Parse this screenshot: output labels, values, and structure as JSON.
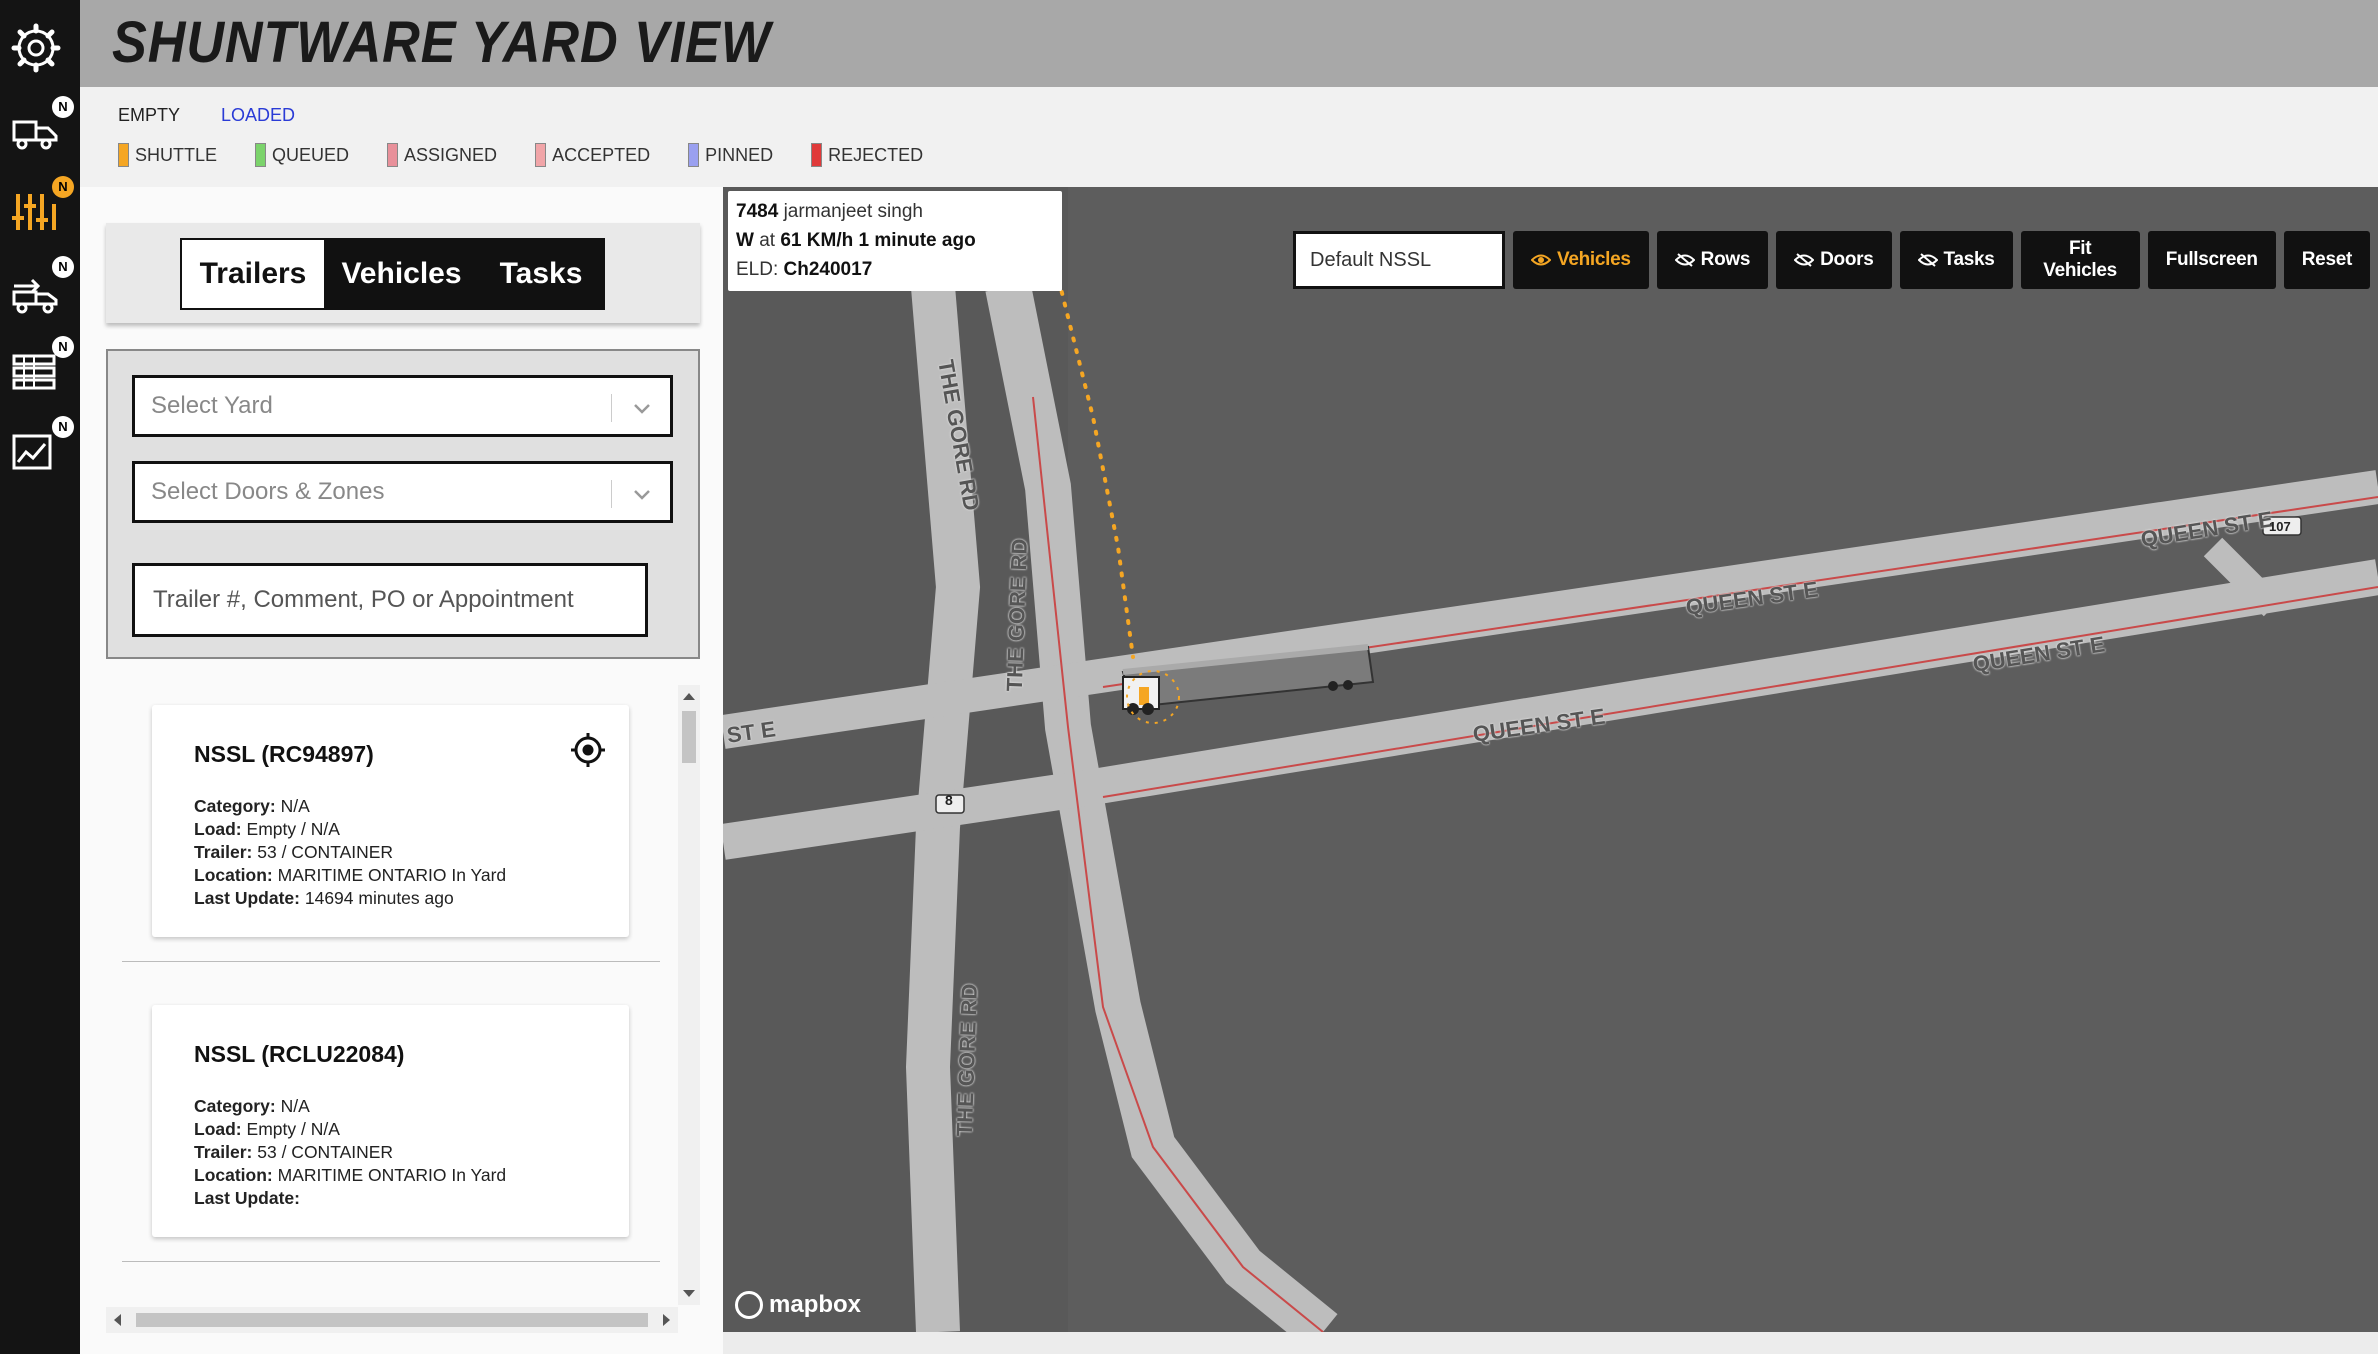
{
  "app": {
    "title": "SHUNTWARE YARD VIEW"
  },
  "rail": [
    {
      "icon": "gear-icon"
    },
    {
      "icon": "truck-dispatch-icon",
      "badge": "N"
    },
    {
      "icon": "yard-equalizer-icon",
      "badge": "N",
      "badge_color": "#f5a623"
    },
    {
      "icon": "truck-move-icon",
      "badge": "N"
    },
    {
      "icon": "list-stack-icon",
      "badge": "N"
    },
    {
      "icon": "analytics-chart-icon",
      "badge": "N"
    }
  ],
  "legend": {
    "load": {
      "empty": "EMPTY",
      "loaded": "LOADED"
    },
    "status": [
      {
        "label": "SHUTTLE",
        "color": "#f5a623"
      },
      {
        "label": "QUEUED",
        "color": "#7bd36b"
      },
      {
        "label": "ASSIGNED",
        "color": "#e8909a"
      },
      {
        "label": "ACCEPTED",
        "color": "#f1a5a8"
      },
      {
        "label": "PINNED",
        "color": "#9aa0f0"
      },
      {
        "label": "REJECTED",
        "color": "#e03a3a"
      }
    ]
  },
  "tabs": {
    "trailers": "Trailers",
    "vehicles": "Vehicles",
    "tasks": "Tasks"
  },
  "filters": {
    "yard_placeholder": "Select Yard",
    "doors_placeholder": "Select Doors & Zones",
    "search_placeholder": "Trailer #, Comment, PO or Appointment"
  },
  "trailers": [
    {
      "title": "NSSL (RC94897)",
      "category_label": "Category:",
      "category": "N/A",
      "load_label": "Load:",
      "load": "Empty / N/A",
      "trailer_label": "Trailer:",
      "trailer": "53 / CONTAINER",
      "location_label": "Location:",
      "location": "MARITIME ONTARIO In Yard",
      "update_label": "Last Update:",
      "update": "14694 minutes ago"
    },
    {
      "title": "NSSL (RCLU22084)",
      "category_label": "Category:",
      "category": "N/A",
      "load_label": "Load:",
      "load": "Empty / N/A",
      "trailer_label": "Trailer:",
      "trailer": "53 / CONTAINER",
      "location_label": "Location:",
      "location": "MARITIME ONTARIO In Yard",
      "update_label": "Last Update:",
      "update": ""
    }
  ],
  "map": {
    "popup": {
      "unit": "7484",
      "driver": "jarmanjeet singh",
      "heading": "W",
      "at": "at",
      "speed": "61 KM/h",
      "ago": "1 minute ago",
      "eld_label": "ELD:",
      "eld": "Ch240017"
    },
    "nssl_value": "Default NSSL",
    "buttons": {
      "vehicles": "Vehicles",
      "rows": "Rows",
      "doors": "Doors",
      "tasks": "Tasks",
      "fit": "Fit Vehicles",
      "fullscreen": "Fullscreen",
      "reset": "Reset"
    },
    "road_labels": {
      "gore_1": "THE GORE RD",
      "gore_2": "THE GORE RD",
      "gore_3": "THE GORE RD",
      "queen_1": "QUEEN ST E",
      "queen_2": "QUEEN ST E",
      "queen_3": "QUEEN ST E",
      "queen_4": "QUEEN ST E",
      "st_e": "ST E",
      "shield_8": "8",
      "shield_107": "107"
    },
    "attribution": "mapbox",
    "accent_color": "#f5a623"
  }
}
